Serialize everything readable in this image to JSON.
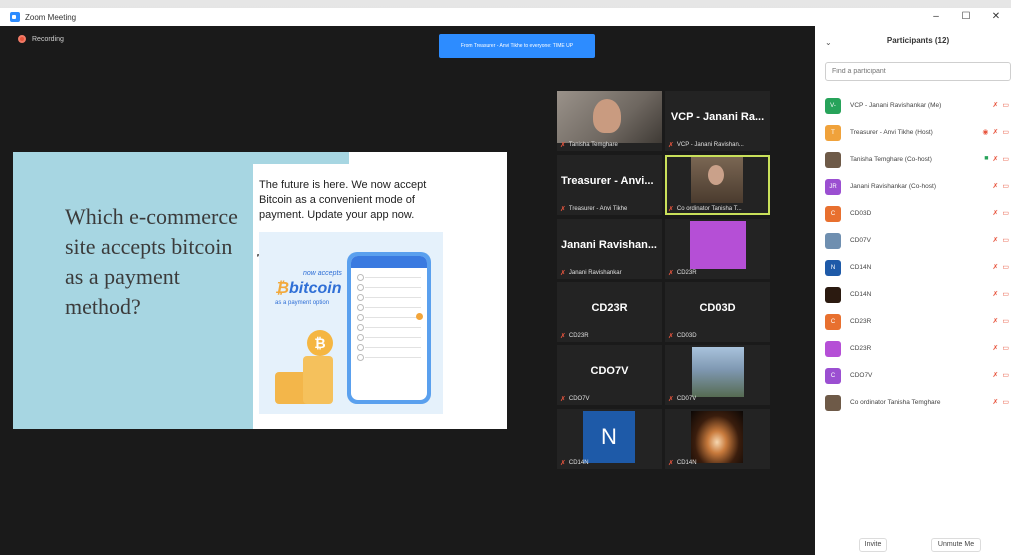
{
  "window": {
    "title": "Zoom Meeting",
    "controls": {
      "minimize": "–",
      "maximize": "☐",
      "close": "✕"
    }
  },
  "recording": {
    "label": "Recording"
  },
  "chat_notification": "From Treasurer - Anvi Tikhe to everyone: TIME UP",
  "slide": {
    "title": "Which e-commerce site accepts bitcoin as a payment method?",
    "text": "The future is here. We now accept Bitcoin as a convenient mode of payment. Update your app now.",
    "promo": {
      "now_accepts": "now accepts",
      "brand": "bitcoin",
      "subtitle": "as a payment option"
    }
  },
  "gallery": [
    {
      "kind": "video-person1",
      "label": "Tanisha Temghare"
    },
    {
      "kind": "name",
      "big": "VCP - Janani Ra...",
      "label": "VCP - Janani Ravishan..."
    },
    {
      "kind": "name-left",
      "big": "Treasurer - Anvi...",
      "label": "Treasurer - Anvi Tikhe"
    },
    {
      "kind": "video-person2",
      "label": "Co ordinator Tanisha T...",
      "active": true
    },
    {
      "kind": "name-left",
      "big": "Janani Ravishan...",
      "label": "Janani Ravishankar"
    },
    {
      "kind": "purple",
      "label": "CD23R"
    },
    {
      "kind": "name",
      "big": "CD23R",
      "label": "CD23R"
    },
    {
      "kind": "name",
      "big": "CD03D",
      "label": "CD03D"
    },
    {
      "kind": "name",
      "big": "CDO7V",
      "label": "CDO7V"
    },
    {
      "kind": "mountain",
      "label": "CD07V"
    },
    {
      "kind": "n-tile",
      "big": "N",
      "label": "CD14N"
    },
    {
      "kind": "fire",
      "label": "CD14N"
    }
  ],
  "panel": {
    "title": "Participants (12)",
    "chevron": "⌄",
    "search_placeholder": "Find a participant",
    "participants": [
      {
        "initials": "V-",
        "color": "#27a35a",
        "name": "VCP - Janani Ravishankar (Me)"
      },
      {
        "initials": "T",
        "color": "#f0a23b",
        "name": "Treasurer - Anvi Tikhe (Host)",
        "recording": true
      },
      {
        "initials": "",
        "color": "#6e5a48",
        "name": "Tanisha Temghare (Co-host)",
        "video_on": true
      },
      {
        "initials": "JR",
        "color": "#9b4fd1",
        "name": "Janani Ravishankar (Co-host)"
      },
      {
        "initials": "C",
        "color": "#e8702f",
        "name": "CD03D"
      },
      {
        "initials": "",
        "color": "#6f8fb0",
        "name": "CD07V"
      },
      {
        "initials": "N",
        "color": "#1e5aa8",
        "name": "CD14N"
      },
      {
        "initials": "",
        "color": "#2b1a10",
        "name": "CD14N"
      },
      {
        "initials": "C",
        "color": "#e8702f",
        "name": "CD23R"
      },
      {
        "initials": "",
        "color": "#b54fd6",
        "name": "CD23R"
      },
      {
        "initials": "C",
        "color": "#9b4fd1",
        "name": "CDO7V"
      },
      {
        "initials": "",
        "color": "#6e5a48",
        "name": "Co ordinator Tanisha Temghare"
      }
    ],
    "invite_label": "Invite",
    "unmute_label": "Unmute Me"
  },
  "colors": {
    "zoom_blue": "#2d8cff",
    "mute_red": "#e8553e",
    "active_speaker": "#c9e05a"
  }
}
